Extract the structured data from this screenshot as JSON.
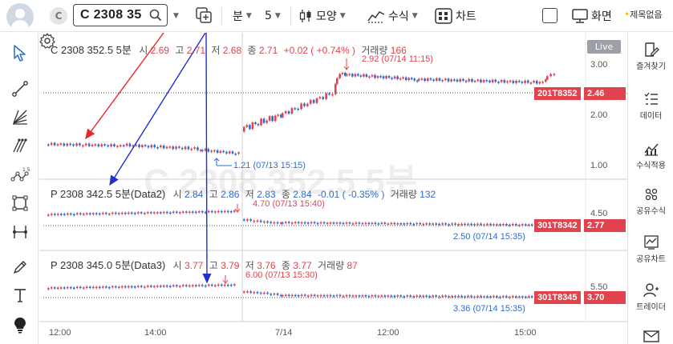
{
  "topbar": {
    "symbol_circle": "C",
    "symbol_text": "C 2308 35",
    "interval_unit": "분",
    "interval_value": "5",
    "style_label": "모양",
    "formula_label": "수식",
    "chart_label": "차트",
    "screen_label": "화면",
    "favorites_badge": "제목없음"
  },
  "sidebar": {
    "items": [
      {
        "label": "즐겨찾기",
        "icon": "bookmark-edit-icon"
      },
      {
        "label": "데이터",
        "icon": "data-list-icon"
      },
      {
        "label": "수식적용",
        "icon": "formula-chart-icon"
      },
      {
        "label": "공유수식",
        "icon": "share-formula-icon"
      },
      {
        "label": "공유차트",
        "icon": "share-chart-icon"
      },
      {
        "label": "트레이더",
        "icon": "trader-icon"
      }
    ]
  },
  "chart": {
    "live_label": "Live",
    "watermark": "C 2308 352.5 5분",
    "x_ticks": [
      "12:00",
      "14:00",
      "7/14",
      "12:00",
      "15:00"
    ],
    "panes": [
      {
        "name": "C 2308 352.5 5분",
        "open_label": "시",
        "open": "2.69",
        "high_label": "고",
        "high": "2.71",
        "low_label": "저",
        "low": "2.68",
        "close_label": "종",
        "close": "2.71",
        "change": "+0.02 ( +0.74% )",
        "volume_label": "거래량",
        "volume": "166",
        "y_ticks": [
          "3.00",
          "2.00",
          "1.00"
        ],
        "tag_code": "201T8352",
        "tag_value": "2.46",
        "high_note": "2.92 (07/14 11:15)",
        "low_note": "1.21 (07/13 15:15)"
      },
      {
        "name": "P 2308 342.5 5분(Data2)",
        "open_label": "시",
        "open": "2.84",
        "high_label": "고",
        "high": "2.86",
        "low_label": "저",
        "low": "2.83",
        "close_label": "종",
        "close": "2.84",
        "change": "-0.01 ( -0.35% )",
        "volume_label": "거래량",
        "volume": "132",
        "y_ticks": [
          "4.50"
        ],
        "tag_code": "301T8342",
        "tag_value": "2.77",
        "high_note": "4.70 (07/13 15:40)",
        "low_note": "2.50 (07/14 15:35)"
      },
      {
        "name": "P 2308 345.0 5분(Data3)",
        "open_label": "시",
        "open": "3.77",
        "high_label": "고",
        "high": "3.79",
        "low_label": "저",
        "low": "3.76",
        "close_label": "종",
        "close": "3.77",
        "change": "",
        "volume_label": "거래량",
        "volume": "87",
        "y_ticks": [
          "5.50"
        ],
        "tag_code": "301T8345",
        "tag_value": "3.70",
        "high_note": "6.00 (07/13 15:30)",
        "low_note": "3.36 (07/14 15:35)"
      }
    ]
  },
  "colors": {
    "up": "#e0434e",
    "down": "#2e6bd1",
    "annotation_red": "#e8262a",
    "annotation_blue": "#1f2fd0"
  }
}
